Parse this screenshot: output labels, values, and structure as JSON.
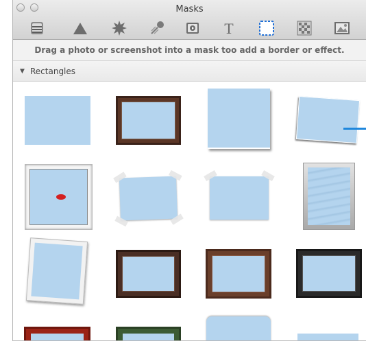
{
  "window": {
    "title": "Masks"
  },
  "toolbar": {
    "items": [
      {
        "icon": "widget-icon"
      },
      {
        "icon": "shape-icon"
      },
      {
        "icon": "starburst-icon"
      },
      {
        "icon": "brush-icon"
      },
      {
        "icon": "movie-icon"
      },
      {
        "icon": "text-icon"
      },
      {
        "icon": "mask-icon",
        "selected": true
      },
      {
        "icon": "pattern-icon"
      },
      {
        "icon": "picture-icon"
      }
    ]
  },
  "hint": "Drag a photo or screenshot into a mask too add a border or effect.",
  "section": {
    "label": "Rectangles",
    "expanded": true
  },
  "masks": [
    {
      "style": "plain-blue"
    },
    {
      "style": "brown-wood-frame"
    },
    {
      "style": "raised-shadow"
    },
    {
      "style": "tilted-edge"
    },
    {
      "style": "white-frame-lip-sticker"
    },
    {
      "style": "taped-tilted"
    },
    {
      "style": "taped-straight"
    },
    {
      "style": "wavy-glass-frame"
    },
    {
      "style": "tilted-white-frame"
    },
    {
      "style": "dark-wood-frame"
    },
    {
      "style": "walnut-frame"
    },
    {
      "style": "black-frame"
    },
    {
      "style": "red-frame"
    },
    {
      "style": "green-frame"
    },
    {
      "style": "rounded-top"
    },
    {
      "style": "plain-short"
    }
  ],
  "colors": {
    "mask_fill": "#b4d4ee",
    "selection": "#1f6fd6",
    "scroll_indicator": "#1f87dc"
  }
}
